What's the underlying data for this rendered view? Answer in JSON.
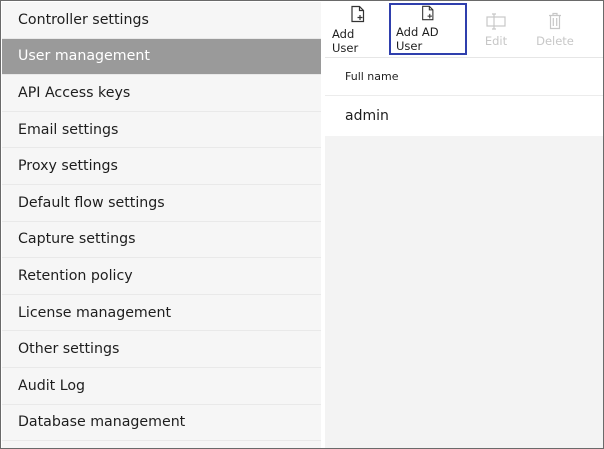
{
  "sidebar": {
    "items": [
      {
        "label": "Controller settings",
        "active": false
      },
      {
        "label": "User management",
        "active": true
      },
      {
        "label": "API Access keys",
        "active": false
      },
      {
        "label": "Email settings",
        "active": false
      },
      {
        "label": "Proxy settings",
        "active": false
      },
      {
        "label": "Default flow settings",
        "active": false
      },
      {
        "label": "Capture settings",
        "active": false
      },
      {
        "label": "Retention policy",
        "active": false
      },
      {
        "label": "License management",
        "active": false
      },
      {
        "label": "Other settings",
        "active": false
      },
      {
        "label": "Audit Log",
        "active": false
      },
      {
        "label": "Database management",
        "active": false
      }
    ]
  },
  "toolbar": {
    "add_user": {
      "label": "Add User",
      "icon": "add-document-icon",
      "enabled": true
    },
    "add_ad_user": {
      "label": "Add AD User",
      "icon": "add-document-icon",
      "enabled": true,
      "highlighted": true
    },
    "edit": {
      "label": "Edit",
      "icon": "edit-icon",
      "enabled": false
    },
    "delete": {
      "label": "Delete",
      "icon": "trash-icon",
      "enabled": false
    }
  },
  "table": {
    "columns": [
      "Full name"
    ],
    "rows": [
      {
        "full_name": "admin"
      }
    ]
  },
  "colors": {
    "active_item_bg": "#9a9a9a",
    "highlight_border": "#2f3fad",
    "disabled_text": "#c7c7c7"
  }
}
